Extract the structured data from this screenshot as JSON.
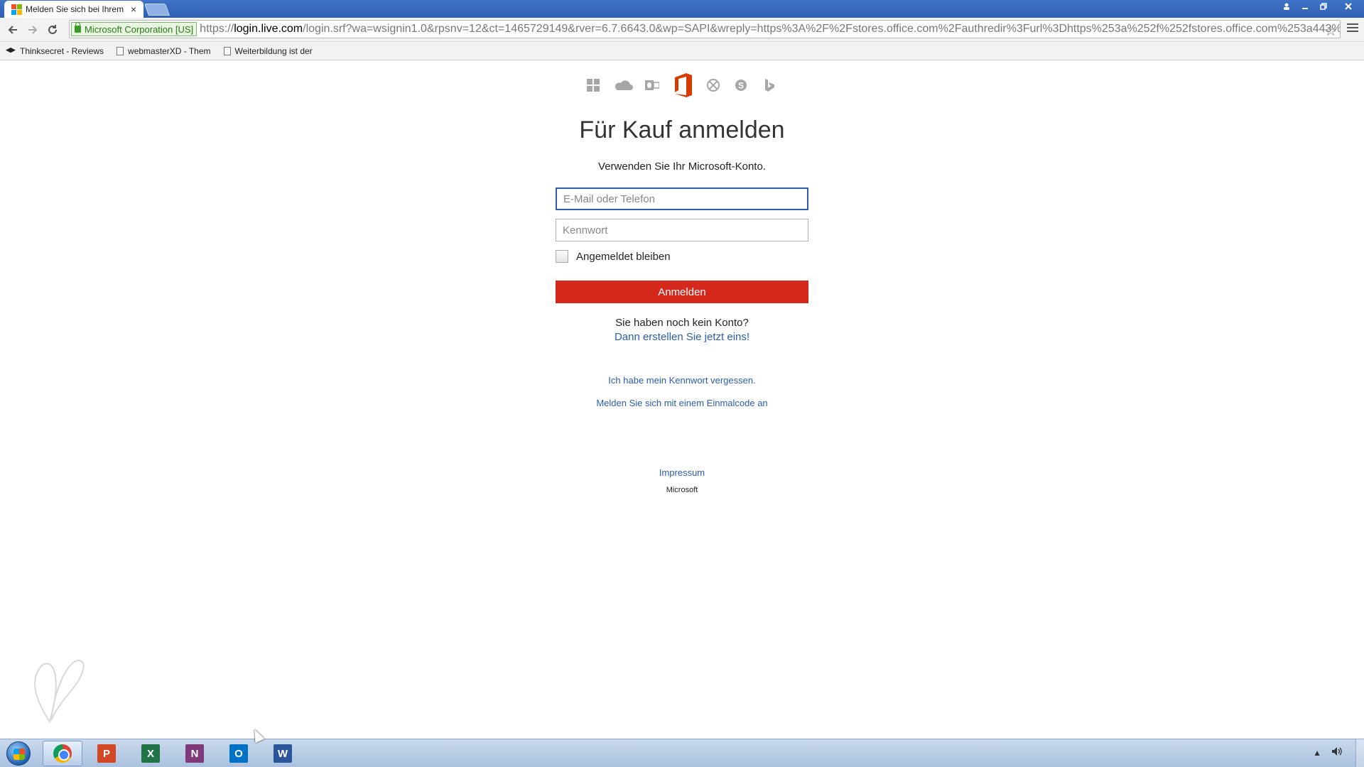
{
  "browser": {
    "tab_title": "Melden Sie sich bei Ihrem",
    "tab_close": "×",
    "ev_badge": "Microsoft Corporation [US]",
    "url_scheme": "https://",
    "url_host": "login.live.com",
    "url_rest": "/login.srf?wa=wsignin1.0&rpsnv=12&ct=1465729149&rver=6.7.6643.0&wp=SAPI&wreply=https%3A%2F%2Fstores.office.com%2Fauthredir%3Furl%3Dhttps%253a%252f%252fstores.office.com%253a443%",
    "bookmarks": [
      {
        "label": "Thinksecret - Reviews",
        "icon": "cap-icon"
      },
      {
        "label": "webmasterXD - Them",
        "icon": "page-icon"
      },
      {
        "label": "Weiterbildung ist der",
        "icon": "page-icon"
      }
    ]
  },
  "page": {
    "brand_icons": [
      "windows-icon",
      "onedrive-icon",
      "outlook-icon",
      "office-icon",
      "xbox-icon",
      "skype-icon",
      "bing-icon"
    ],
    "title": "Für Kauf anmelden",
    "subtitle": "Verwenden Sie Ihr Microsoft-Konto.",
    "email_placeholder": "E-Mail oder Telefon",
    "password_placeholder": "Kennwort",
    "remember_label": "Angemeldet bleiben",
    "signin_label": "Anmelden",
    "no_account": "Sie haben noch kein Konto?",
    "create_account": "Dann erstellen Sie jetzt eins!",
    "forgot_password": "Ich habe mein Kennwort vergessen.",
    "one_time_code": "Melden Sie sich mit einem Einmalcode an",
    "impressum": "Impressum",
    "footer_brand": "Microsoft"
  },
  "taskbar": {
    "apps": [
      "chrome-icon",
      "powerpoint-icon",
      "excel-icon",
      "onenote-icon",
      "outlook-icon",
      "word-icon"
    ],
    "app_letters": {
      "powerpoint": "P",
      "excel": "X",
      "onenote": "N",
      "outlook": "O",
      "word": "W"
    }
  },
  "colors": {
    "accent_red": "#d5281c",
    "link_blue": "#2a5db0",
    "office_orange": "#d83b01",
    "icon_gray": "#a6a6a6"
  }
}
